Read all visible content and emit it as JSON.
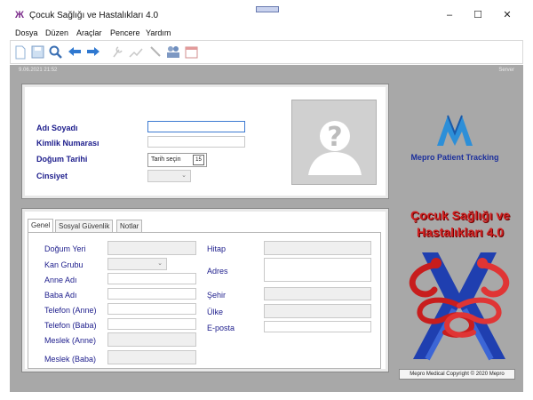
{
  "window": {
    "title": "Çocuk Sağlığı ve Hastalıkları 4.0",
    "minimize_glyph": "–",
    "maximize_glyph": "☐",
    "close_glyph": "✕"
  },
  "menu": [
    {
      "label": "Dosya"
    },
    {
      "label": "Düzen"
    },
    {
      "label": "Araçlar"
    },
    {
      "label": "Pencere"
    },
    {
      "label": "Yardım"
    }
  ],
  "toolbar": {
    "icons": [
      "new-document-icon",
      "save-icon",
      "search-icon",
      "back-arrow-icon",
      "forward-arrow-icon",
      "tools-icon",
      "chart-icon",
      "pen-icon",
      "users-icon",
      "calendar-icon"
    ]
  },
  "status": {
    "datetime": "9.06.2021 21:52",
    "server": "Server"
  },
  "patient": {
    "name_label": "Adı Soyadı",
    "id_label": "Kimlik Numarası",
    "birth_label": "Doğum Tarihi",
    "birth_placeholder": "Tarih seçin",
    "calendar_day": "15",
    "gender_label": "Cinsiyet"
  },
  "brand": {
    "caption": "Mepro Patient Tracking",
    "app_name_line1": "Çocuk Sağlığı ve",
    "app_name_line2": "Hastalıkları 4.0",
    "copyright": "Mepro Medical Copyright ©  2020 Mepro"
  },
  "tabs": [
    {
      "label": "Genel"
    },
    {
      "label": "Sosyal Güvenlik"
    },
    {
      "label": "Notlar"
    }
  ],
  "general": {
    "birthplace": "Doğum Yeri",
    "blood_group": "Kan Grubu",
    "mother_name": "Anne Adı",
    "father_name": "Baba Adı",
    "phone_mother": "Telefon (Anne)",
    "phone_father": "Telefon (Baba)",
    "job_mother": "Meslek (Anne)",
    "job_father": "Meslek (Baba)",
    "title": "Hitap",
    "address": "Adres",
    "city": "Şehir",
    "country": "Ülke",
    "email": "E-posta"
  },
  "colors": {
    "label_blue": "#1d1d8c",
    "brand_red": "#d01f1f",
    "brand_blue": "#1b2f9c",
    "workspace_gray": "#a8a8a8"
  }
}
